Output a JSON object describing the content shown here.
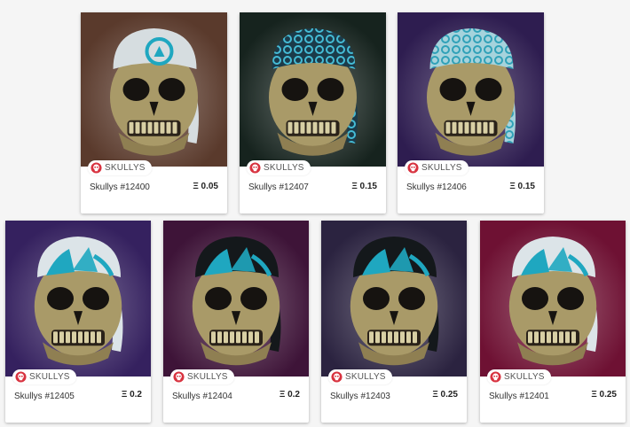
{
  "collection_label": "SKULLYS",
  "eth_symbol": "Ξ",
  "cards": [
    {
      "name": "Skullys #12400",
      "price": "0.05",
      "bg": "#5a3a2c",
      "bandana": "#d6dde0",
      "pattern": "#1fa7c0",
      "style": "logo"
    },
    {
      "name": "Skullys #12407",
      "price": "0.15",
      "bg": "#16231e",
      "bandana": "#1b3b4a",
      "pattern": "#45bcd6",
      "style": "rings"
    },
    {
      "name": "Skullys #12406",
      "price": "0.15",
      "bg": "#2e1d50",
      "bandana": "#a5d3dc",
      "pattern": "#2fa1b8",
      "style": "rings"
    },
    {
      "name": "Skullys #12405",
      "price": "0.2",
      "bg": "#35215f",
      "bandana": "#dce4e8",
      "pattern": "#1fa7c0",
      "style": "ship"
    },
    {
      "name": "Skullys #12404",
      "price": "0.2",
      "bg": "#3e1438",
      "bandana": "#14181b",
      "pattern": "#1fa7c0",
      "style": "ship"
    },
    {
      "name": "Skullys #12403",
      "price": "0.25",
      "bg": "#2b2340",
      "bandana": "#14181b",
      "pattern": "#1fa7c0",
      "style": "ship"
    },
    {
      "name": "Skullys #12401",
      "price": "0.25",
      "bg": "#6e1133",
      "bandana": "#dce4e8",
      "pattern": "#1fa7c0",
      "style": "ship"
    }
  ]
}
